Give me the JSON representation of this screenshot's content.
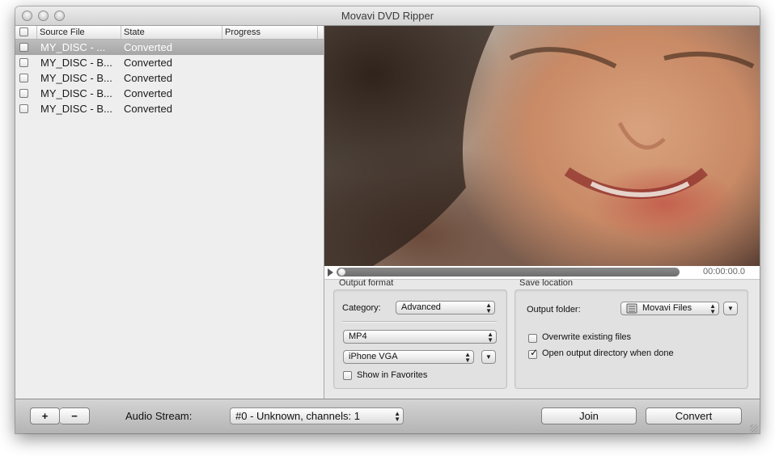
{
  "window": {
    "title": "Movavi DVD Ripper"
  },
  "filelist": {
    "columns": {
      "source": "Source File",
      "state": "State",
      "progress": "Progress"
    },
    "rows": [
      {
        "source": "MY_DISC - ...",
        "state": "Converted",
        "selected": true
      },
      {
        "source": "MY_DISC - B...",
        "state": "Converted",
        "selected": false
      },
      {
        "source": "MY_DISC - B...",
        "state": "Converted",
        "selected": false
      },
      {
        "source": "MY_DISC - B...",
        "state": "Converted",
        "selected": false
      },
      {
        "source": "MY_DISC - B...",
        "state": "Converted",
        "selected": false
      }
    ]
  },
  "player": {
    "timecode": "00:00:00.0",
    "position": 0
  },
  "output_format": {
    "title": "Output format",
    "category_label": "Category:",
    "category_value": "Advanced",
    "format_value": "MP4",
    "preset_value": "iPhone VGA",
    "favorites_label": "Show in Favorites",
    "favorites_checked": false
  },
  "save_location": {
    "title": "Save location",
    "folder_label": "Output folder:",
    "folder_value": "Movavi Files",
    "folder_icon": "folder-icon",
    "overwrite_label": "Overwrite existing files",
    "overwrite_checked": false,
    "open_dir_label": "Open output directory when done",
    "open_dir_checked": true
  },
  "bottombar": {
    "add_label": "+",
    "remove_label": "−",
    "audio_label": "Audio Stream:",
    "audio_value": "#0 - Unknown, channels: 1",
    "join_label": "Join",
    "convert_label": "Convert"
  },
  "icons": {
    "updown": "▲▼",
    "down": "▼",
    "check": "✓",
    "play": "play-icon"
  }
}
